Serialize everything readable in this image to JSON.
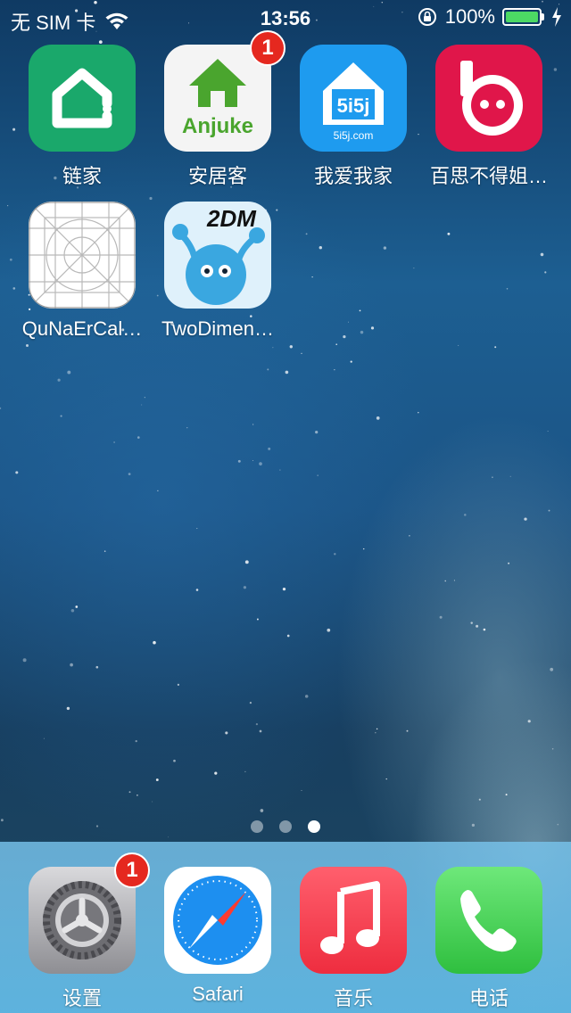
{
  "status_bar": {
    "carrier": "无 SIM 卡",
    "time": "13:56",
    "battery_percent": "100%",
    "battery_level": 1.0,
    "icons": [
      "wifi-icon",
      "orientation-lock-icon",
      "charging-bolt-icon"
    ]
  },
  "apps": [
    {
      "label": "链家",
      "icon": "lianjia-house-icon",
      "color": "#1aa86b",
      "badge": ""
    },
    {
      "label": "安居客",
      "icon": "anjuke-icon",
      "color": "#ffffff",
      "badge": "1",
      "icon_text": "Anjuke"
    },
    {
      "label": "我爱我家",
      "icon": "5i5j-icon",
      "color": "#1e9bef",
      "badge": "",
      "icon_text": "5i5j.com"
    },
    {
      "label": "百思不得姐…",
      "icon": "baisibudejie-icon",
      "color": "#e0164a",
      "badge": ""
    },
    {
      "label": "QuNaErCal…",
      "icon": "placeholder-grid-icon",
      "color": "#ffffff",
      "badge": ""
    },
    {
      "label": "TwoDimen…",
      "icon": "2dm-icon",
      "color": "#3aa7e0",
      "badge": "",
      "icon_text": "2DM"
    }
  ],
  "page_dots": {
    "count": 3,
    "active": 3
  },
  "dock": [
    {
      "label": "设置",
      "icon": "settings-gear-icon",
      "badge": "1"
    },
    {
      "label": "Safari",
      "icon": "safari-compass-icon",
      "badge": ""
    },
    {
      "label": "音乐",
      "icon": "music-note-icon",
      "badge": ""
    },
    {
      "label": "电话",
      "icon": "phone-handset-icon",
      "badge": ""
    }
  ]
}
